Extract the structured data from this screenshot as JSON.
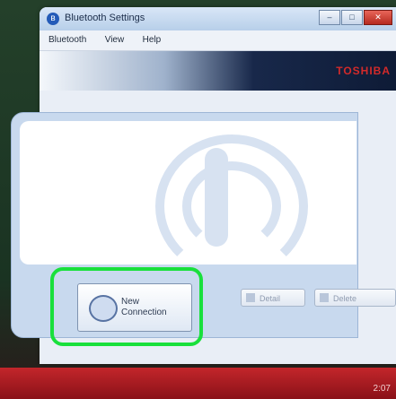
{
  "window": {
    "title": "Bluetooth Settings",
    "menu": [
      "Bluetooth",
      "View",
      "Help"
    ],
    "brand": "TOSHIBA",
    "controls": [
      "minimize",
      "maximize",
      "close"
    ]
  },
  "buttons": {
    "new_connection": "New\nConnection",
    "detail": "Detail",
    "delete": "Delete"
  },
  "taskbar": {
    "tray_text": "2:07"
  },
  "colors": {
    "highlight": "#19e03c",
    "taskbar": "#c3262b",
    "brand": "#d32a2a"
  },
  "icons": {
    "title": "bluetooth-icon",
    "content": "wireless-signal-icon",
    "new_connection": "bluetooth-connection-icon"
  }
}
